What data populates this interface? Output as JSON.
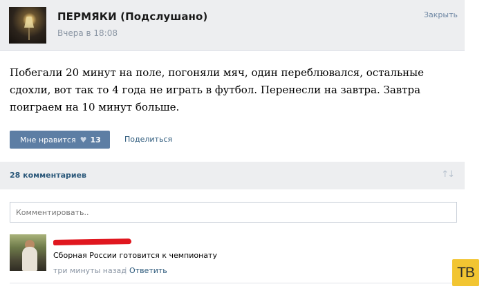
{
  "header": {
    "group_name": "ПЕРМЯКИ (Подслушано)",
    "post_time": "Вчера в 18:08",
    "close_label": "Закрыть"
  },
  "post": {
    "text": "Побегали 20 минут на поле, погоняли мяч, один переблювался, остальные сдохли, вот так то 4 года не играть в футбол. Перенесли на завтра. Завтра поиграем на 10 минут больше."
  },
  "actions": {
    "like_label": "Мне нравится",
    "like_icon": "heart-icon",
    "like_count": "13",
    "share_label": "Поделиться"
  },
  "comments": {
    "count_label": "28 комментариев",
    "sort_icon": "sort-arrows-icon",
    "input_placeholder": "Комментировать..",
    "items": [
      {
        "text": "Сборная России готовится к чемпионату",
        "time": "три минуты назад",
        "separator": "|",
        "reply_label": "Ответить"
      }
    ]
  },
  "watermark": "TB",
  "colors": {
    "header_bg": "#edeef0",
    "button_bg": "#5d7ea4",
    "link": "#2b587a",
    "meta_text": "#8b96a4",
    "redaction": "#e0171f",
    "watermark_bg": "#f2c532"
  }
}
